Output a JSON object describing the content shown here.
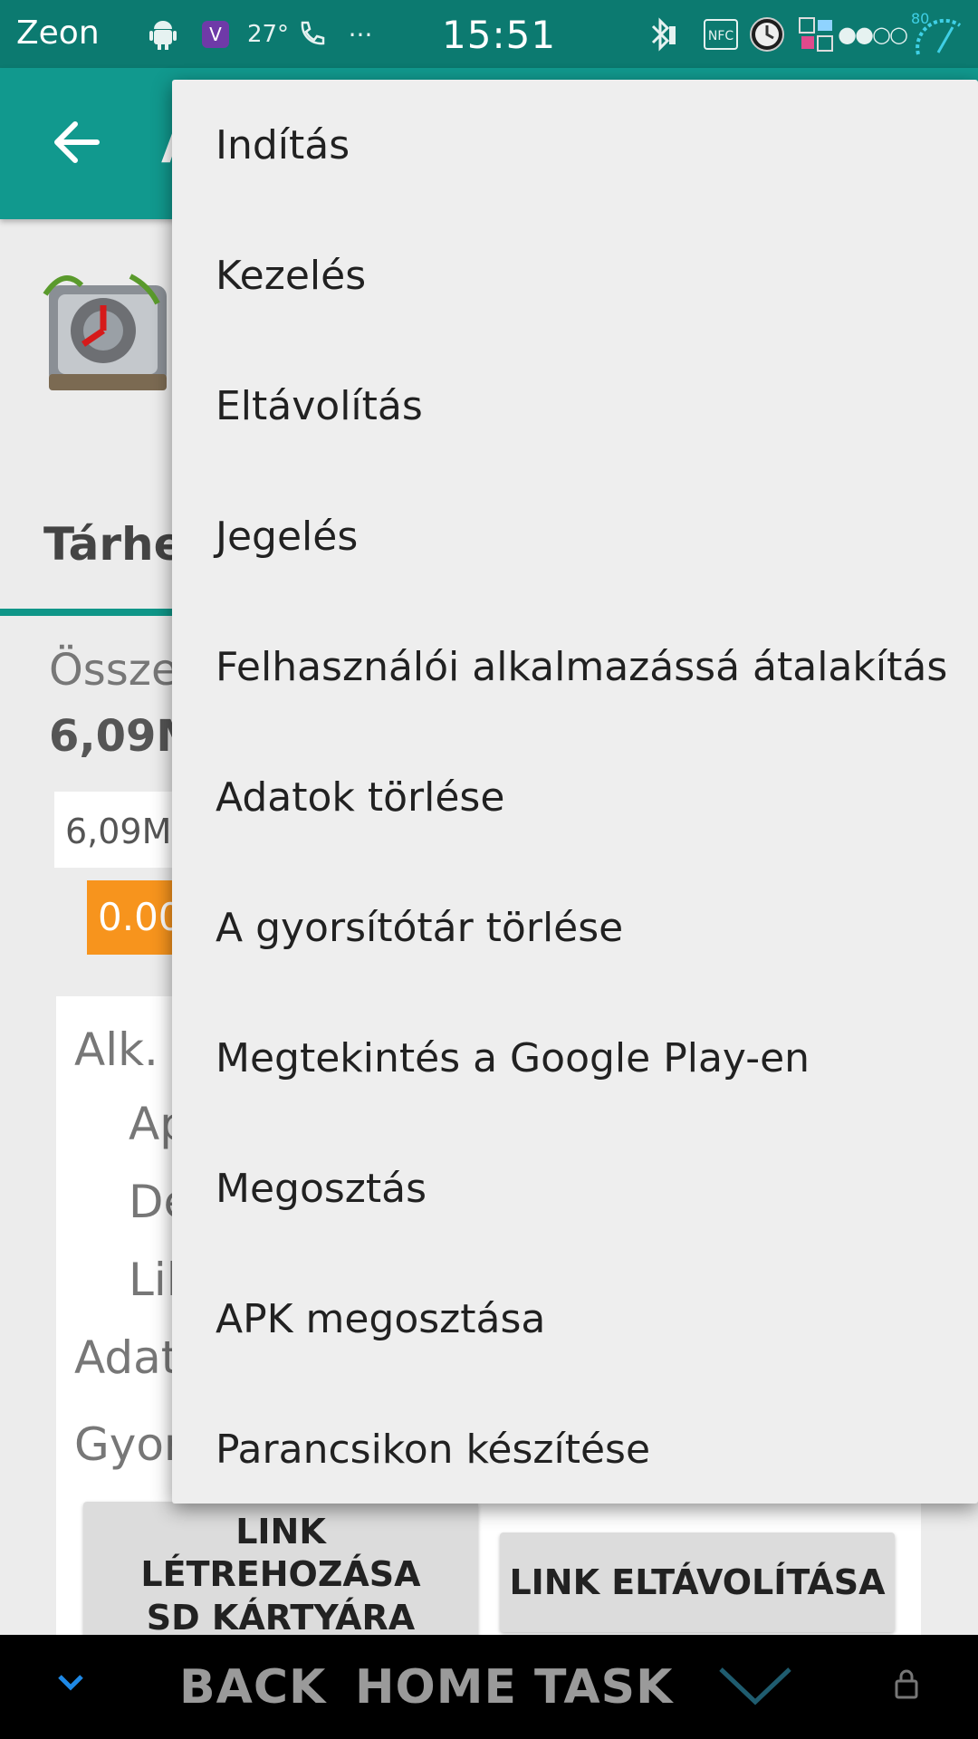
{
  "status_bar": {
    "carrier": "Zeon",
    "time": "15:51",
    "temperature": "27°",
    "battery_level": "80",
    "icons": [
      "android-debug-icon",
      "viber-icon",
      "phone-call-icon",
      "more-dots-icon",
      "bluetooth-icon",
      "nfc-icon",
      "clock-icon",
      "app-icon",
      "signal-dots-icon",
      "battery-gauge-icon"
    ],
    "nfc_label": "NFC"
  },
  "app_bar": {
    "title_visible": "A"
  },
  "background": {
    "section_title": "Tárhel",
    "total_label": "Össze",
    "total_value": "6,09M",
    "bar_white_text": "6,09M",
    "bar_orange_text": "0.00",
    "rows": [
      "Alk.",
      "Ap",
      "De",
      "Lil",
      "Adat",
      "Gyor"
    ],
    "buttons": {
      "link_create": "LINK LÉTREHOZÁSA SD KÁRTYÁRA",
      "link_remove": "LINK ELTÁVOLÍTÁSA"
    }
  },
  "menu": {
    "items": [
      "Indítás",
      "Kezelés",
      "Eltávolítás",
      "Jegelés",
      "Felhasználói alkalmazássá átalakítás",
      "Adatok törlése",
      "A gyorsítótár törlése",
      "Megtekintés a Google Play-en",
      "Megosztás",
      "APK megosztása",
      "Parancsikon készítése"
    ]
  },
  "nav_bar": {
    "back": "BACK",
    "home": "HOME",
    "task": "TASK"
  },
  "colors": {
    "status_bar": "#0c7a70",
    "app_bar": "#11998e",
    "accent_orange": "#f7941d",
    "menu_bg": "#eeeeee",
    "nav_bar": "#000000"
  }
}
